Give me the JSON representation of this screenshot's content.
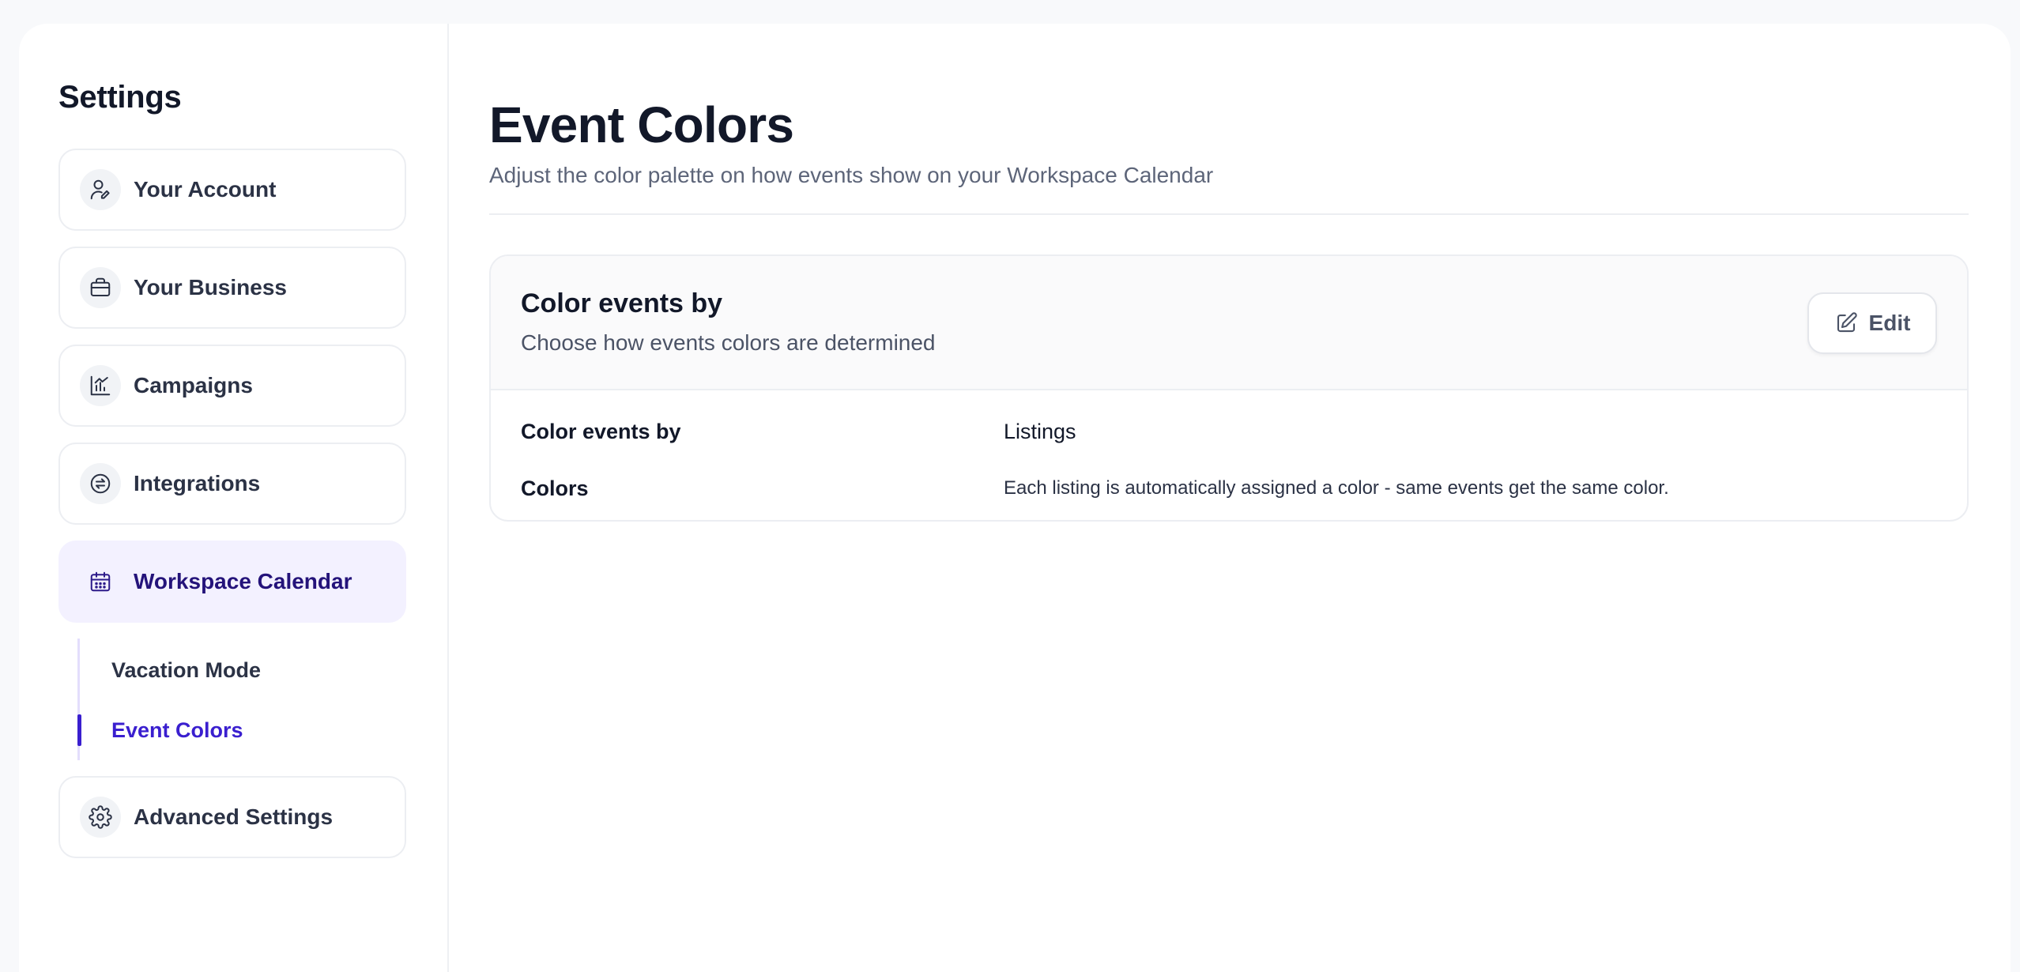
{
  "sidebar": {
    "title": "Settings",
    "items": [
      {
        "label": "Your Account",
        "icon": "user-edit-icon"
      },
      {
        "label": "Your Business",
        "icon": "briefcase-icon"
      },
      {
        "label": "Campaigns",
        "icon": "chart-icon"
      },
      {
        "label": "Integrations",
        "icon": "swap-icon"
      },
      {
        "label": "Workspace Calendar",
        "icon": "calendar-icon",
        "active": true
      },
      {
        "label": "Advanced Settings",
        "icon": "gear-icon"
      }
    ],
    "subitems": [
      {
        "label": "Vacation Mode"
      },
      {
        "label": "Event Colors",
        "active": true
      }
    ]
  },
  "main": {
    "title": "Event Colors",
    "subtitle": "Adjust the color palette on how events show on your Workspace Calendar",
    "card": {
      "title": "Color events by",
      "description": "Choose how events colors are determined",
      "edit_label": "Edit",
      "rows": [
        {
          "label": "Color events by",
          "value": "Listings"
        },
        {
          "label": "Colors",
          "value": "Each listing is automatically assigned a color - same events get the same color."
        }
      ]
    }
  },
  "colors": {
    "accent": "#3a1fcf",
    "active_bg": "#f3f1ff",
    "text_primary": "#121829",
    "text_secondary": "#5d6579"
  }
}
